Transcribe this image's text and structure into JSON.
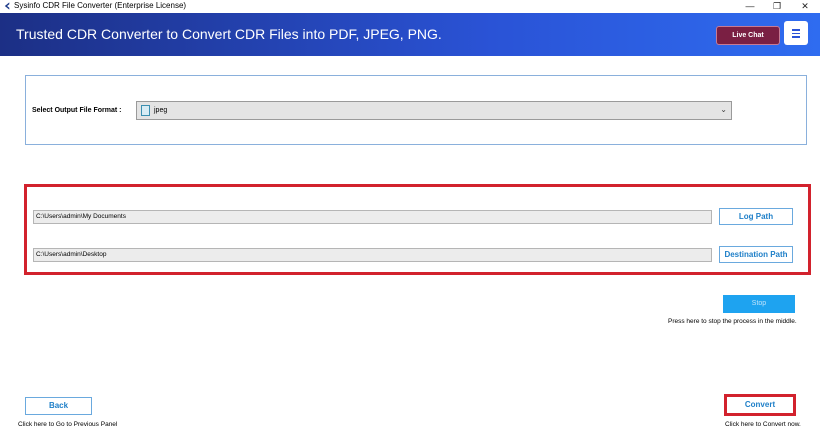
{
  "window": {
    "title": "Sysinfo CDR File Converter (Enterprise License)",
    "minimize_glyph": "—",
    "restore_glyph": "❐",
    "close_glyph": "✕"
  },
  "header": {
    "headline": "Trusted CDR Converter to Convert CDR Files into PDF, JPEG, PNG.",
    "live_chat_label": "Live Chat",
    "menu_icon": "hamburger-icon"
  },
  "format": {
    "label": "Select Output File Format :",
    "selected_value": "jpeg",
    "icon": "image-file-icon"
  },
  "paths": {
    "log_path_value": "C:\\Users\\admin\\My Documents",
    "log_path_button": "Log Path",
    "destination_value": "C:\\Users\\admin\\Desktop",
    "destination_button": "Destination Path"
  },
  "stop": {
    "label": "Stop",
    "hint": "Press here to stop the process in the middle."
  },
  "footer": {
    "back_label": "Back",
    "back_hint": "Click here to Go to Previous Panel",
    "convert_label": "Convert",
    "convert_hint": "Click here to Convert now."
  },
  "colors": {
    "header_gradient_start": "#1c2f85",
    "header_gradient_end": "#2f6cf0",
    "live_chat_bg": "#7a1f43",
    "highlight_red": "#d2222d",
    "button_text_blue": "#1e7fc8",
    "stop_button_bg": "#1ea3f0"
  }
}
